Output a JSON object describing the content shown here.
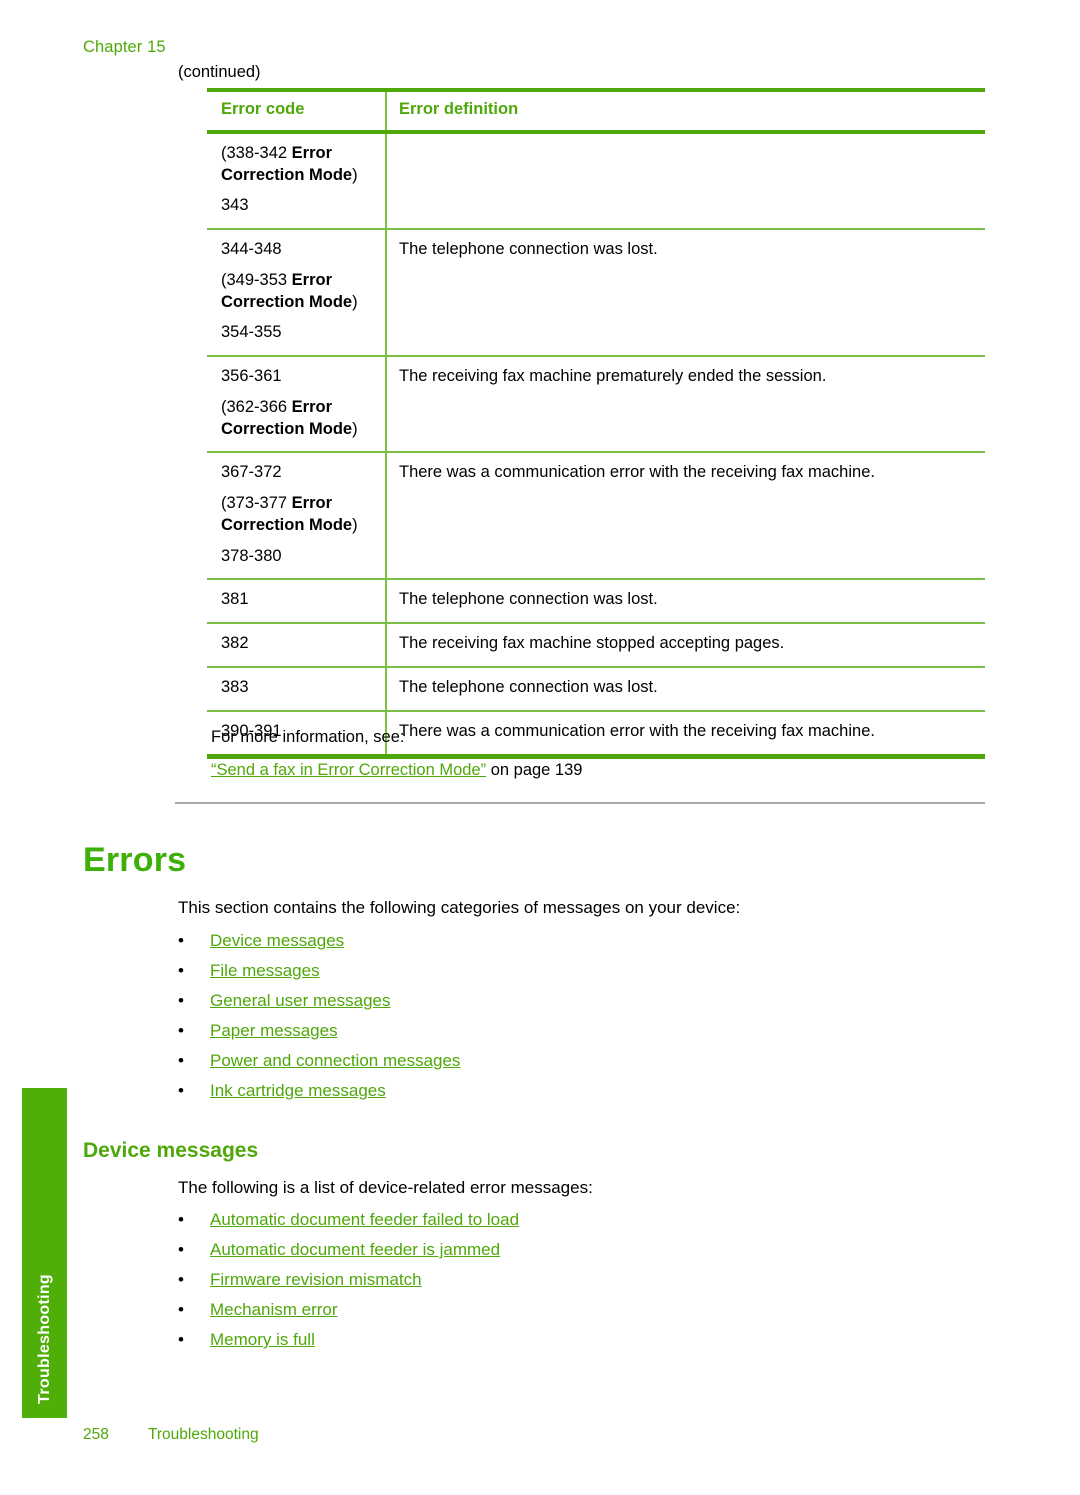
{
  "page": {
    "chapter_label": "Chapter 15",
    "continued_label": "(continued)",
    "side_tab_label": "Troubleshooting",
    "footer_page_number": "258",
    "footer_section": "Troubleshooting",
    "accent_green": "#4fa80a",
    "heading_green": "#3cb007",
    "rule_green": "#7cc043",
    "divider_gray": "#a8a8a8"
  },
  "table": {
    "headers": {
      "code": "Error code",
      "definition": "Error definition"
    },
    "rows": [
      {
        "code_lines": [
          {
            "pre": "(338-342 ",
            "bold": "Error Correction Mode",
            "post": ")"
          },
          {
            "pre": "343",
            "bold": "",
            "post": ""
          }
        ],
        "definition": ""
      },
      {
        "code_lines": [
          {
            "pre": "344-348",
            "bold": "",
            "post": ""
          },
          {
            "pre": "(349-353 ",
            "bold": "Error Correction Mode",
            "post": ")"
          },
          {
            "pre": "354-355",
            "bold": "",
            "post": ""
          }
        ],
        "definition": "The telephone connection was lost."
      },
      {
        "code_lines": [
          {
            "pre": "356-361",
            "bold": "",
            "post": ""
          },
          {
            "pre": "(362-366 ",
            "bold": "Error Correction Mode",
            "post": ")"
          }
        ],
        "definition": "The receiving fax machine prematurely ended the session."
      },
      {
        "code_lines": [
          {
            "pre": "367-372",
            "bold": "",
            "post": ""
          },
          {
            "pre": "(373-377 ",
            "bold": "Error Correction Mode",
            "post": ")"
          },
          {
            "pre": "378-380",
            "bold": "",
            "post": ""
          }
        ],
        "definition": "There was a communication error with the receiving fax machine."
      },
      {
        "code_lines": [
          {
            "pre": "381",
            "bold": "",
            "post": ""
          }
        ],
        "definition": "The telephone connection was lost."
      },
      {
        "code_lines": [
          {
            "pre": "382",
            "bold": "",
            "post": ""
          }
        ],
        "definition": "The receiving fax machine stopped accepting pages."
      },
      {
        "code_lines": [
          {
            "pre": "383",
            "bold": "",
            "post": ""
          }
        ],
        "definition": "The telephone connection was lost."
      },
      {
        "code_lines": [
          {
            "pre": "390-391",
            "bold": "",
            "post": ""
          }
        ],
        "definition": "There was a communication error with the receiving fax machine."
      }
    ]
  },
  "cross_reference": {
    "lead_in": "For more information, see:",
    "link_text": "“Send a fax in Error Correction Mode”",
    "tail_text": " on page 139"
  },
  "errors_section": {
    "heading": "Errors",
    "intro": "This section contains the following categories of messages on your device:",
    "links": [
      "Device messages",
      "File messages",
      "General user messages",
      "Paper messages",
      "Power and connection messages",
      "Ink cartridge messages"
    ]
  },
  "device_messages_section": {
    "heading": "Device messages",
    "intro": "The following is a list of device-related error messages:",
    "links": [
      "Automatic document feeder failed to load",
      "Automatic document feeder is jammed",
      "Firmware revision mismatch",
      "Mechanism error",
      "Memory is full"
    ]
  },
  "bullet_glyph": "•"
}
